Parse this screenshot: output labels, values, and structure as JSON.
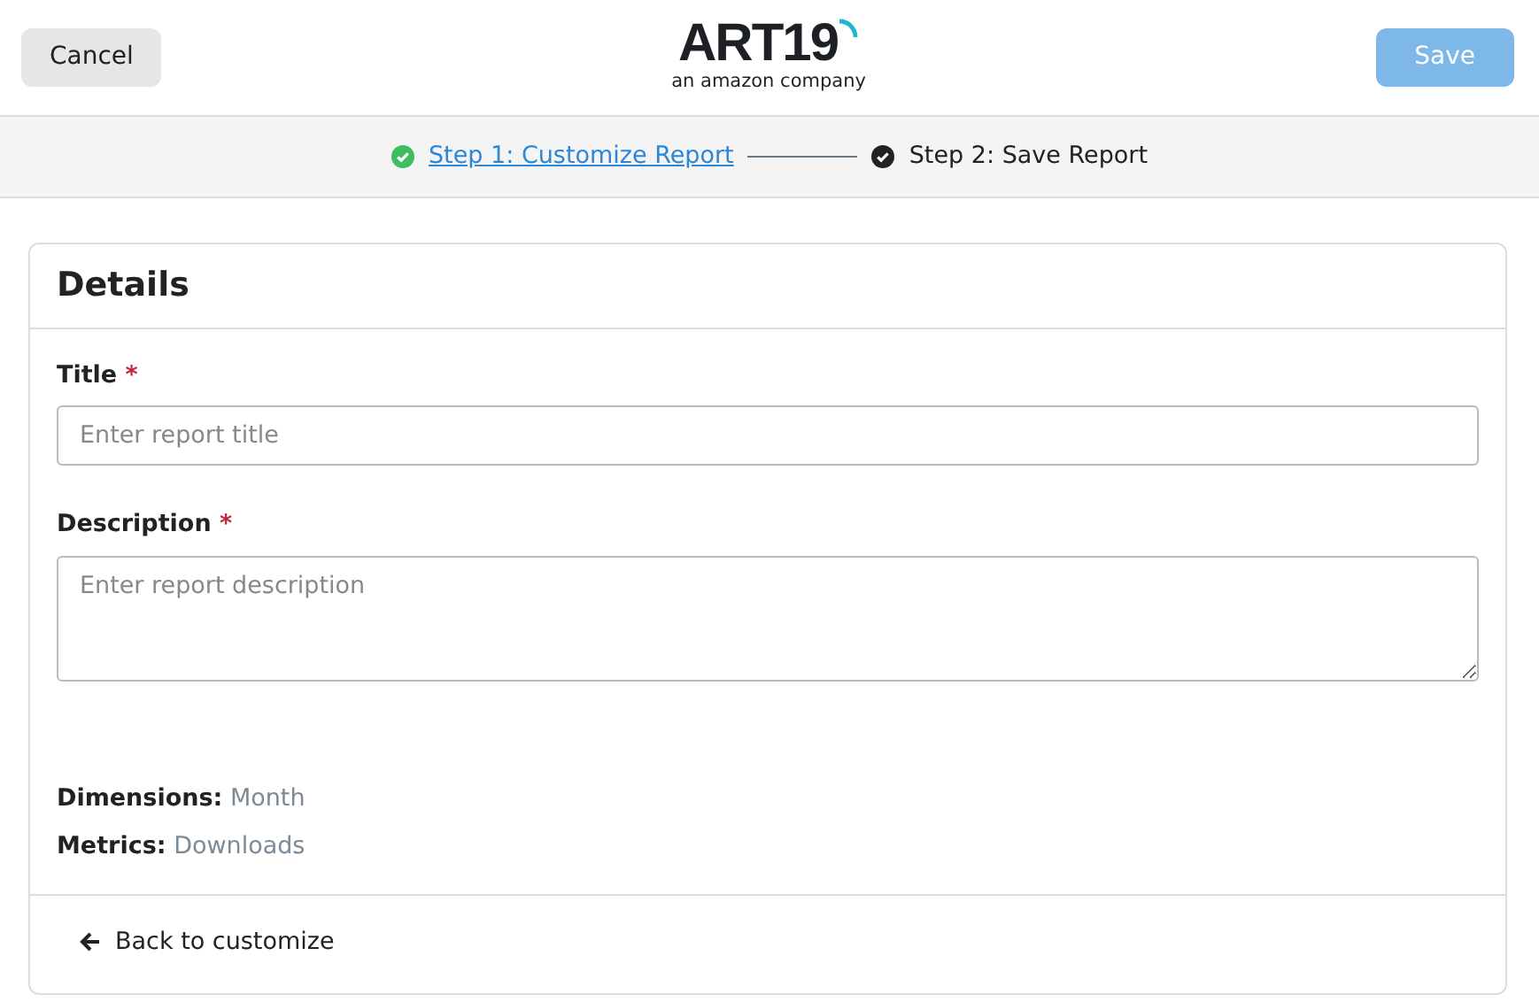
{
  "header": {
    "cancel_button": "Cancel",
    "logo": {
      "wordmark": "ART19",
      "tagline": "an amazon company"
    },
    "save_button": {
      "label": "Save",
      "disabled": true
    }
  },
  "steps": [
    {
      "label": "Step 1: Customize Report",
      "completed": true,
      "selected": false
    },
    {
      "label": "Step 2: Save Report",
      "completed": false,
      "selected": true
    }
  ],
  "card": {
    "title": "Details",
    "fields": [
      {
        "kind": "input",
        "label": "Title",
        "required_mark": "*",
        "placeholder": "Enter report title"
      },
      {
        "kind": "textarea",
        "label": "Description",
        "required_mark": "*",
        "placeholder": "Enter report description"
      }
    ],
    "summary": [
      {
        "label": "Dimensions:",
        "value": "Month"
      },
      {
        "label": "Metrics:",
        "value": "Downloads"
      }
    ],
    "back_link": "Back to customize"
  }
}
